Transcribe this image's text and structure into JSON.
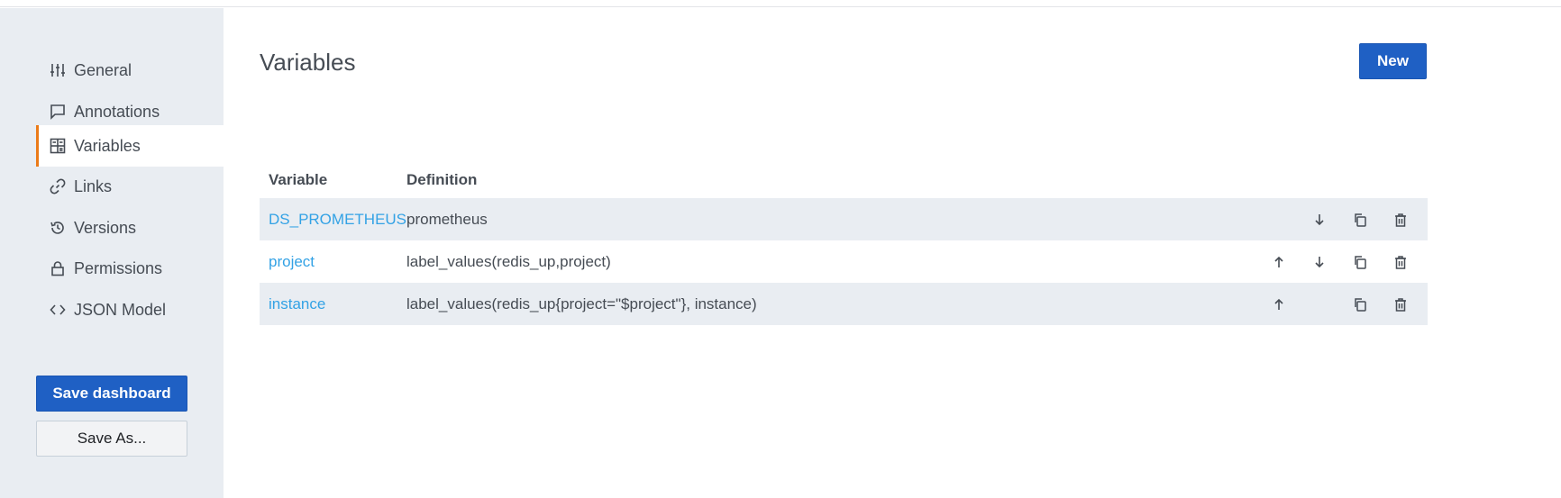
{
  "sidebar": {
    "items": [
      {
        "label": "General",
        "icon": "sliders-icon"
      },
      {
        "label": "Annotations",
        "icon": "comment-icon"
      },
      {
        "label": "Variables",
        "icon": "calculator-icon",
        "active": true
      },
      {
        "label": "Links",
        "icon": "link-icon"
      },
      {
        "label": "Versions",
        "icon": "history-icon"
      },
      {
        "label": "Permissions",
        "icon": "lock-icon"
      },
      {
        "label": "JSON Model",
        "icon": "code-icon"
      }
    ],
    "save_dashboard_label": "Save dashboard",
    "save_as_label": "Save As..."
  },
  "main": {
    "title": "Variables",
    "new_button_label": "New",
    "table": {
      "headers": {
        "variable": "Variable",
        "definition": "Definition"
      },
      "rows": [
        {
          "variable": "DS_PROMETHEUS",
          "definition": "prometheus",
          "move_up": false,
          "move_down": true
        },
        {
          "variable": "project",
          "definition": "label_values(redis_up,project)",
          "move_up": true,
          "move_down": true
        },
        {
          "variable": "instance",
          "definition": "label_values(redis_up{project=\"$project\"}, instance)",
          "move_up": true,
          "move_down": false
        }
      ]
    }
  },
  "colors": {
    "primary": "#1f60c4",
    "link": "#33a2e5",
    "active_accent": "#eb7b18",
    "sidebar_bg": "#e9edf2"
  }
}
